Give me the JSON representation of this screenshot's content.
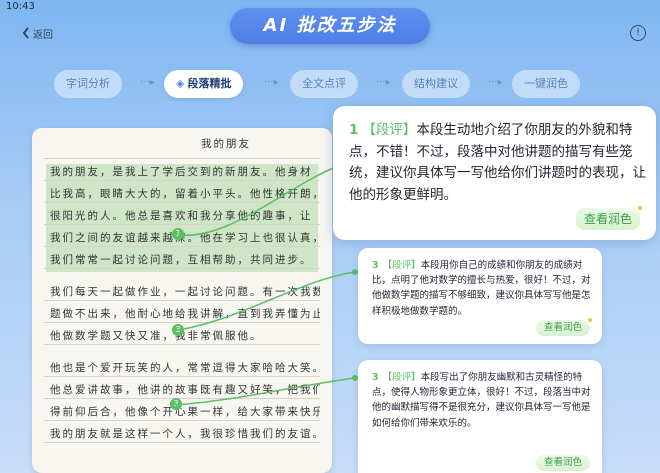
{
  "status_bar": {
    "time": "10:43"
  },
  "header": {
    "back_label": "返回",
    "title": "AI 批改五步法"
  },
  "tabs": [
    {
      "label": "字词分析",
      "active": false
    },
    {
      "label": "段落精批",
      "active": true
    },
    {
      "label": "全文点评",
      "active": false
    },
    {
      "label": "结构建议",
      "active": false
    },
    {
      "label": "一键润色",
      "active": false
    }
  ],
  "essay": {
    "title": "我的朋友",
    "lines": [
      "我的朋友，是我上了学后交到的新朋友。他身材",
      "比我高，眼睛大大的，留着小平头。他性格开朗，是个",
      "很阳光的人。他总是喜欢和我分享他的趣事，让",
      "我们之间的友谊越来越深。他在学习上也很认真，",
      "我们常常一起讨论问题，互相帮助，共同进步。",
      "我们每天一起做作业，一起讨论问题。有一次我数学",
      "题做不出来，他耐心地给我讲解，直到我弄懂为止。",
      "他做数学题又快又准，我非常佩服他。",
      "他也是个爱开玩笑的人，常常逗得大家哈哈大笑。",
      "他总爱讲故事，他讲的故事既有趣又好笑，把我们逗",
      "得前仰后合，他像个开心果一样，给大家带来快乐。",
      "我的朋友就是这样一个人，我很珍惜我们的友谊。"
    ],
    "markers": [
      "1",
      "3",
      "3"
    ]
  },
  "feedback": [
    {
      "num": "1",
      "tag": "【段评】",
      "text": "本段生动地介绍了你朋友的外貌和特点，不错！不过，段落中对他讲题的描写有些笼统，建议你具体写一写他给你们讲题时的表现，让他的形象更鲜明。",
      "button": "查看润色"
    },
    {
      "num": "3",
      "tag": "【段评】",
      "text": "本段用你自己的成绩和你朋友的成绩对比，点明了他对数学的擅长与热爱，很好！不过，对他做数学题的描写不够细致，建议你具体写写他是怎样积极地做数学题的。",
      "button": "查看润色"
    },
    {
      "num": "3",
      "tag": "【段评】",
      "text": "本段写出了你朋友幽默和古灵精怪的特点，使得人物形象更立体，很好！不过，段落当中对他的幽默描写得不是很充分，建议你具体写一写他是如何给你们带来欢乐的。",
      "button": "查看润色"
    }
  ],
  "colors": {
    "accent": "#5bbf63",
    "banner": "#5f8ff0"
  }
}
